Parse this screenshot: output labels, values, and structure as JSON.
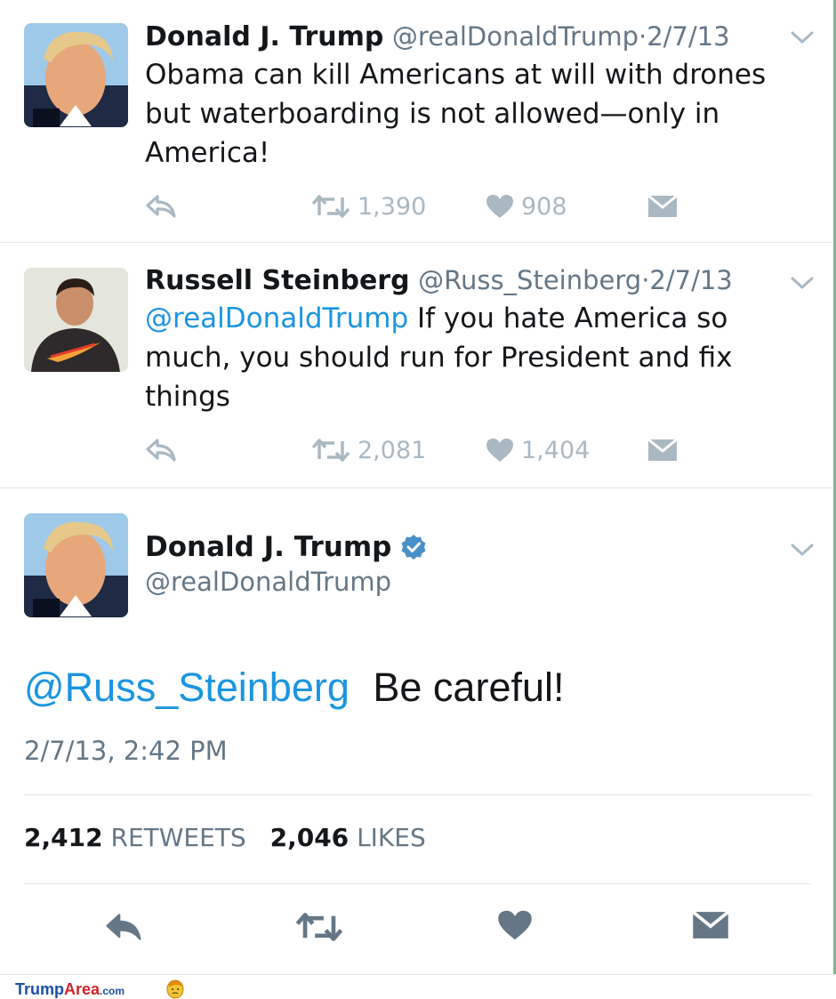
{
  "tweets": [
    {
      "name": "Donald J. Trump",
      "handle": "@realDonaldTrump",
      "dot": "·",
      "date": "2/7/13",
      "text": "Obama can kill Americans at will with drones but waterboarding is not allowed—only in America!",
      "retweets": "1,390",
      "likes": "908"
    },
    {
      "name": "Russell Steinberg",
      "handle": "@Russ_Steinberg",
      "dot": "·",
      "date": "2/7/13",
      "mention": "@realDonaldTrump",
      "text": " If you hate America so much, you should run for President and fix things",
      "retweets": "2,081",
      "likes": "1,404"
    }
  ],
  "main_tweet": {
    "name": "Donald J. Trump",
    "handle": "@realDonaldTrump",
    "mention": "@Russ_Steinberg",
    "text": "Be careful!",
    "timestamp": "2/7/13, 2:42 PM",
    "retweets_count": "2,412",
    "retweets_label": "RETWEETS",
    "likes_count": "2,046",
    "likes_label": "LIKES"
  },
  "icons": {
    "reply": "reply-icon",
    "retweet": "retweet-icon",
    "like": "heart-icon",
    "dm": "envelope-icon",
    "menu": "chevron-down-icon",
    "verified": "verified-badge-icon"
  },
  "footer": {
    "logo_part1": "Trump",
    "logo_part2": "Area",
    "logo_part3": ".com"
  },
  "colors": {
    "link": "#1b95e0",
    "secondary_text": "#657786",
    "action_icon": "#aab8c2",
    "main_action_icon": "#657786",
    "verified": "#1da1f2"
  }
}
